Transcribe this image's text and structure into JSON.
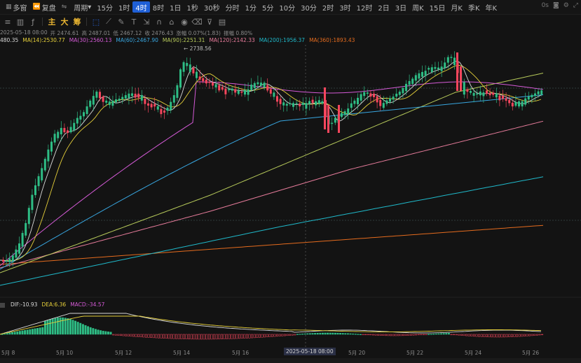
{
  "toolbar": {
    "items": [
      {
        "label": "多窗",
        "icon": "grid-icon",
        "active": false
      },
      {
        "label": "复盘",
        "icon": "rewind-icon",
        "active": false
      },
      {
        "label": "",
        "icon": "compare-icon",
        "active": false
      },
      {
        "label": "周期",
        "icon": "",
        "active": false
      },
      {
        "label": "15分",
        "active": false
      },
      {
        "label": "1时",
        "active": false
      },
      {
        "label": "4时",
        "active": true
      },
      {
        "label": "8时",
        "active": false
      },
      {
        "label": "1日",
        "active": false
      },
      {
        "label": "1秒",
        "active": false
      },
      {
        "label": "30秒",
        "active": false
      },
      {
        "label": "分时",
        "active": false
      },
      {
        "label": "1分",
        "active": false
      },
      {
        "label": "5分",
        "active": false
      },
      {
        "label": "10分",
        "active": false
      },
      {
        "label": "30分",
        "active": false
      },
      {
        "label": "2时",
        "active": false
      },
      {
        "label": "3时",
        "active": false
      },
      {
        "label": "12时",
        "active": false
      },
      {
        "label": "2日",
        "active": false
      },
      {
        "label": "3日",
        "active": false
      },
      {
        "label": "周K",
        "active": false
      },
      {
        "label": "15日",
        "active": false
      },
      {
        "label": "月K",
        "active": false
      },
      {
        "label": "季K",
        "active": false
      },
      {
        "label": "年K",
        "active": false
      }
    ],
    "countdown": "0s"
  },
  "tools": {
    "labels": [
      "主",
      "大",
      "筹"
    ]
  },
  "ohlc": {
    "time": "2025-05-18 08:00",
    "open": "开 2474.61",
    "high": "高 2487.01",
    "low": "低 2467.12",
    "close": "收 2476.43",
    "change": "涨幅 0.07%(1.83)",
    "amp": "振幅 0.80%"
  },
  "ma": {
    "ma7": "480.35",
    "ma14": "MA(14):2530.77",
    "ma30": "MA(30):2560.13",
    "ma60": "MA(60):2467.90",
    "ma90": "MA(90):2251.31",
    "ma120": "MA(120):2142.33",
    "ma200": "MA(200):1956.37",
    "ma360": "MA(360):1893.43"
  },
  "macd": {
    "dif": "DIF:-10.93",
    "dea": "DEA:6.36",
    "macd": "MACD:-34.57"
  },
  "annotation": {
    "high_marker": "← 2738.56"
  },
  "xaxis": {
    "labels": [
      "5月 8",
      "5月 10",
      "5月 12",
      "5月 14",
      "5月 16",
      "5月 20",
      "5月 22",
      "5月 24",
      "5月 26"
    ],
    "crosshair": "2025-05-18 08:00"
  },
  "colors": {
    "up": "#2ebd85",
    "down": "#f6465d",
    "bg": "#131313",
    "ma7": "#d9d9d9",
    "ma14": "#e5cf3a",
    "ma30": "#d45ad6",
    "ma60": "#38a6e0",
    "ma90": "#b6c95a",
    "ma120": "#e57b9a",
    "ma200": "#1fb8c9",
    "ma360": "#e46b1e"
  }
}
